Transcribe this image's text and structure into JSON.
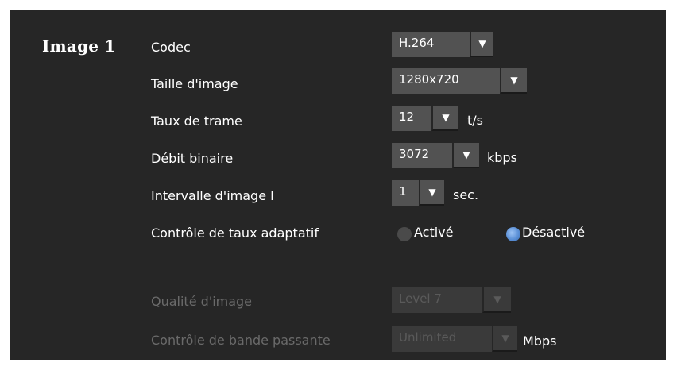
{
  "section": {
    "title": "Image 1"
  },
  "codec": {
    "label": "Codec",
    "value": "H.264"
  },
  "image_size": {
    "label": "Taille d'image",
    "value": "1280x720"
  },
  "frame_rate": {
    "label": "Taux de trame",
    "value": "12",
    "unit": "t/s"
  },
  "bit_rate": {
    "label": "Débit binaire",
    "value": "3072",
    "unit": "kbps"
  },
  "i_frame_interval": {
    "label": "Intervalle d'image I",
    "value": "1",
    "unit": "sec."
  },
  "adaptive_rate": {
    "label": "Contrôle de taux adaptatif",
    "options": [
      {
        "label": "Activé",
        "selected": false
      },
      {
        "label": "Désactivé",
        "selected": true
      }
    ]
  },
  "image_quality": {
    "label": "Qualité d'image",
    "value": "Level 7",
    "disabled": true
  },
  "bandwidth": {
    "label": "Contrôle de bande passante",
    "value": "Unlimited",
    "unit": "Mbps",
    "disabled": true
  },
  "icons": {
    "dropdown": "dropdown-arrow-icon",
    "radio": "radio-button-icon"
  },
  "colors": {
    "background": "#262626",
    "control": "#525252",
    "radio_selected": "#5a8fd6"
  }
}
